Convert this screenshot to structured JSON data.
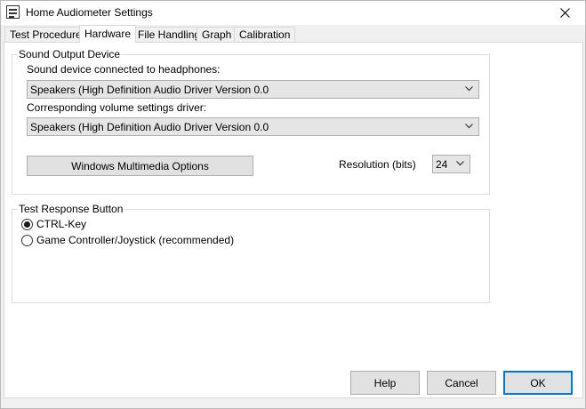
{
  "window": {
    "title": "Home Audiometer Settings"
  },
  "tabs": [
    {
      "label": "Test Procedure"
    },
    {
      "label": "Hardware"
    },
    {
      "label": "File Handling"
    },
    {
      "label": "Graph"
    },
    {
      "label": "Calibration"
    }
  ],
  "sound_output": {
    "group_title": "Sound Output Device",
    "headphones_label": "Sound device connected to headphones:",
    "headphones_value": "Speakers (High Definition Audio Driver Version 0.0",
    "volume_label": "Corresponding volume settings driver:",
    "volume_value": "Speakers (High Definition Audio Driver Version 0.0",
    "wmm_button": "Windows Multimedia Options",
    "resolution_label": "Resolution (bits)",
    "resolution_value": "24"
  },
  "test_response": {
    "group_title": "Test Response Button",
    "options": [
      {
        "label": "CTRL-Key",
        "checked": true
      },
      {
        "label": "Game Controller/Joystick (recommended)",
        "checked": false
      }
    ]
  },
  "buttons": {
    "help": "Help",
    "cancel": "Cancel",
    "ok": "OK"
  }
}
